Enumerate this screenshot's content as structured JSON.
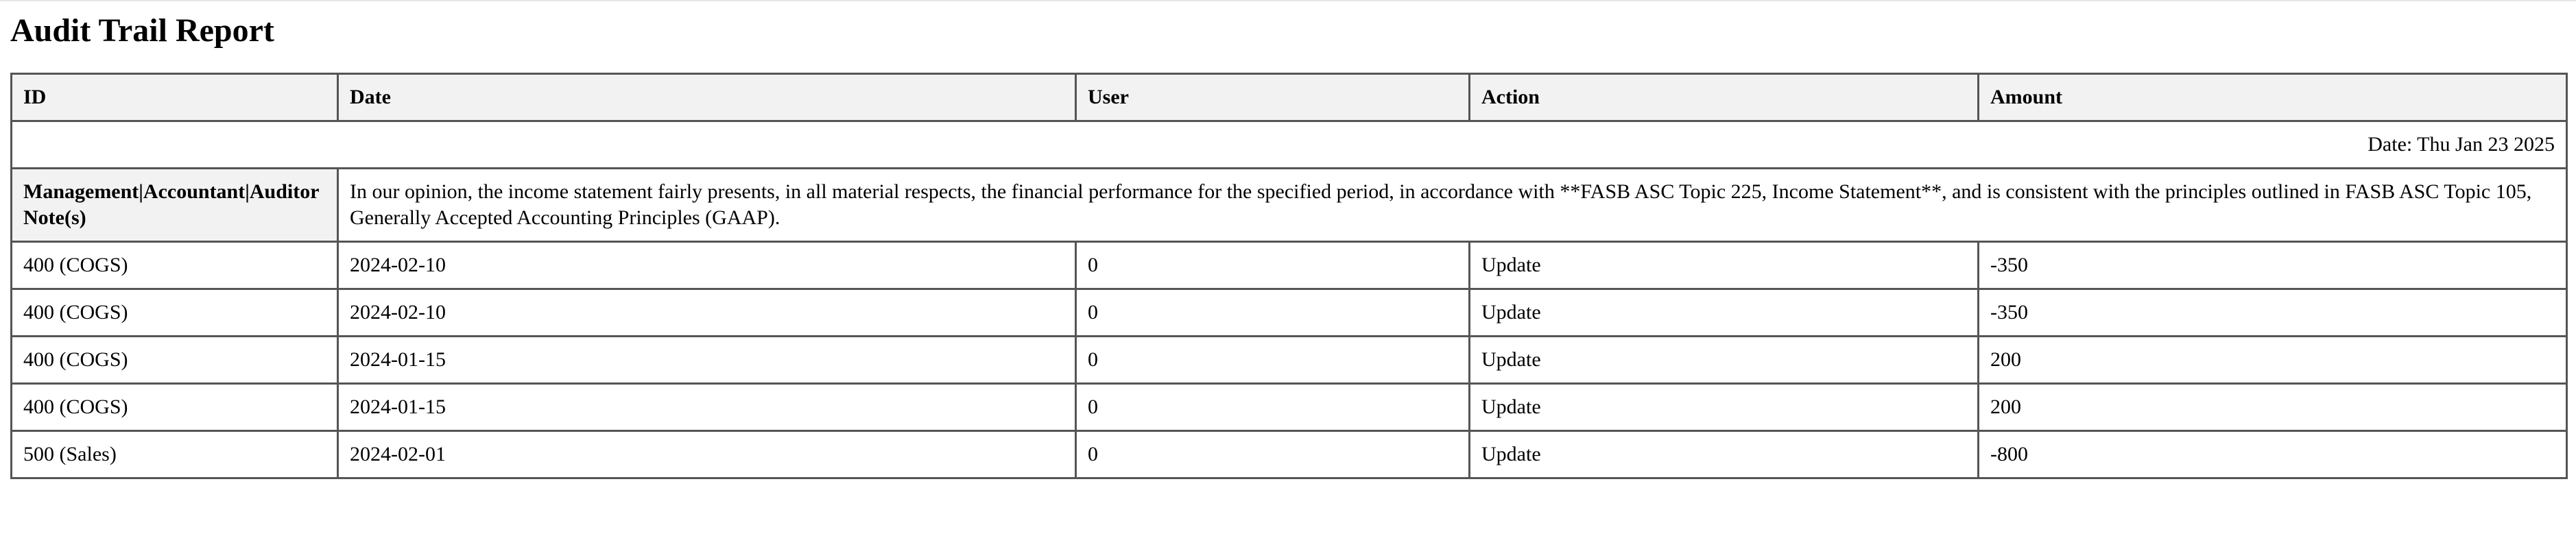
{
  "report": {
    "title": "Audit Trail Report"
  },
  "table": {
    "headers": {
      "id": "ID",
      "date": "Date",
      "user": "User",
      "action": "Action",
      "amount": "Amount"
    },
    "date_line": "Date: Thu Jan 23 2025",
    "note": {
      "label": "Management|Accountant|Auditor Note(s)",
      "text": "In our opinion, the income statement fairly presents, in all material respects, the financial performance for the specified period, in accordance with **FASB ASC Topic 225, Income Statement**, and is consistent with the principles outlined in FASB ASC Topic 105, Generally Accepted Accounting Principles (GAAP)."
    },
    "rows": [
      {
        "id": "400 (COGS)",
        "date": "2024-02-10",
        "user": "0",
        "action": "Update",
        "amount": "-350"
      },
      {
        "id": "400 (COGS)",
        "date": "2024-02-10",
        "user": "0",
        "action": "Update",
        "amount": "-350"
      },
      {
        "id": "400 (COGS)",
        "date": "2024-01-15",
        "user": "0",
        "action": "Update",
        "amount": "200"
      },
      {
        "id": "400 (COGS)",
        "date": "2024-01-15",
        "user": "0",
        "action": "Update",
        "amount": "200"
      },
      {
        "id": "500 (Sales)",
        "date": "2024-02-01",
        "user": "0",
        "action": "Update",
        "amount": "-800"
      }
    ]
  }
}
